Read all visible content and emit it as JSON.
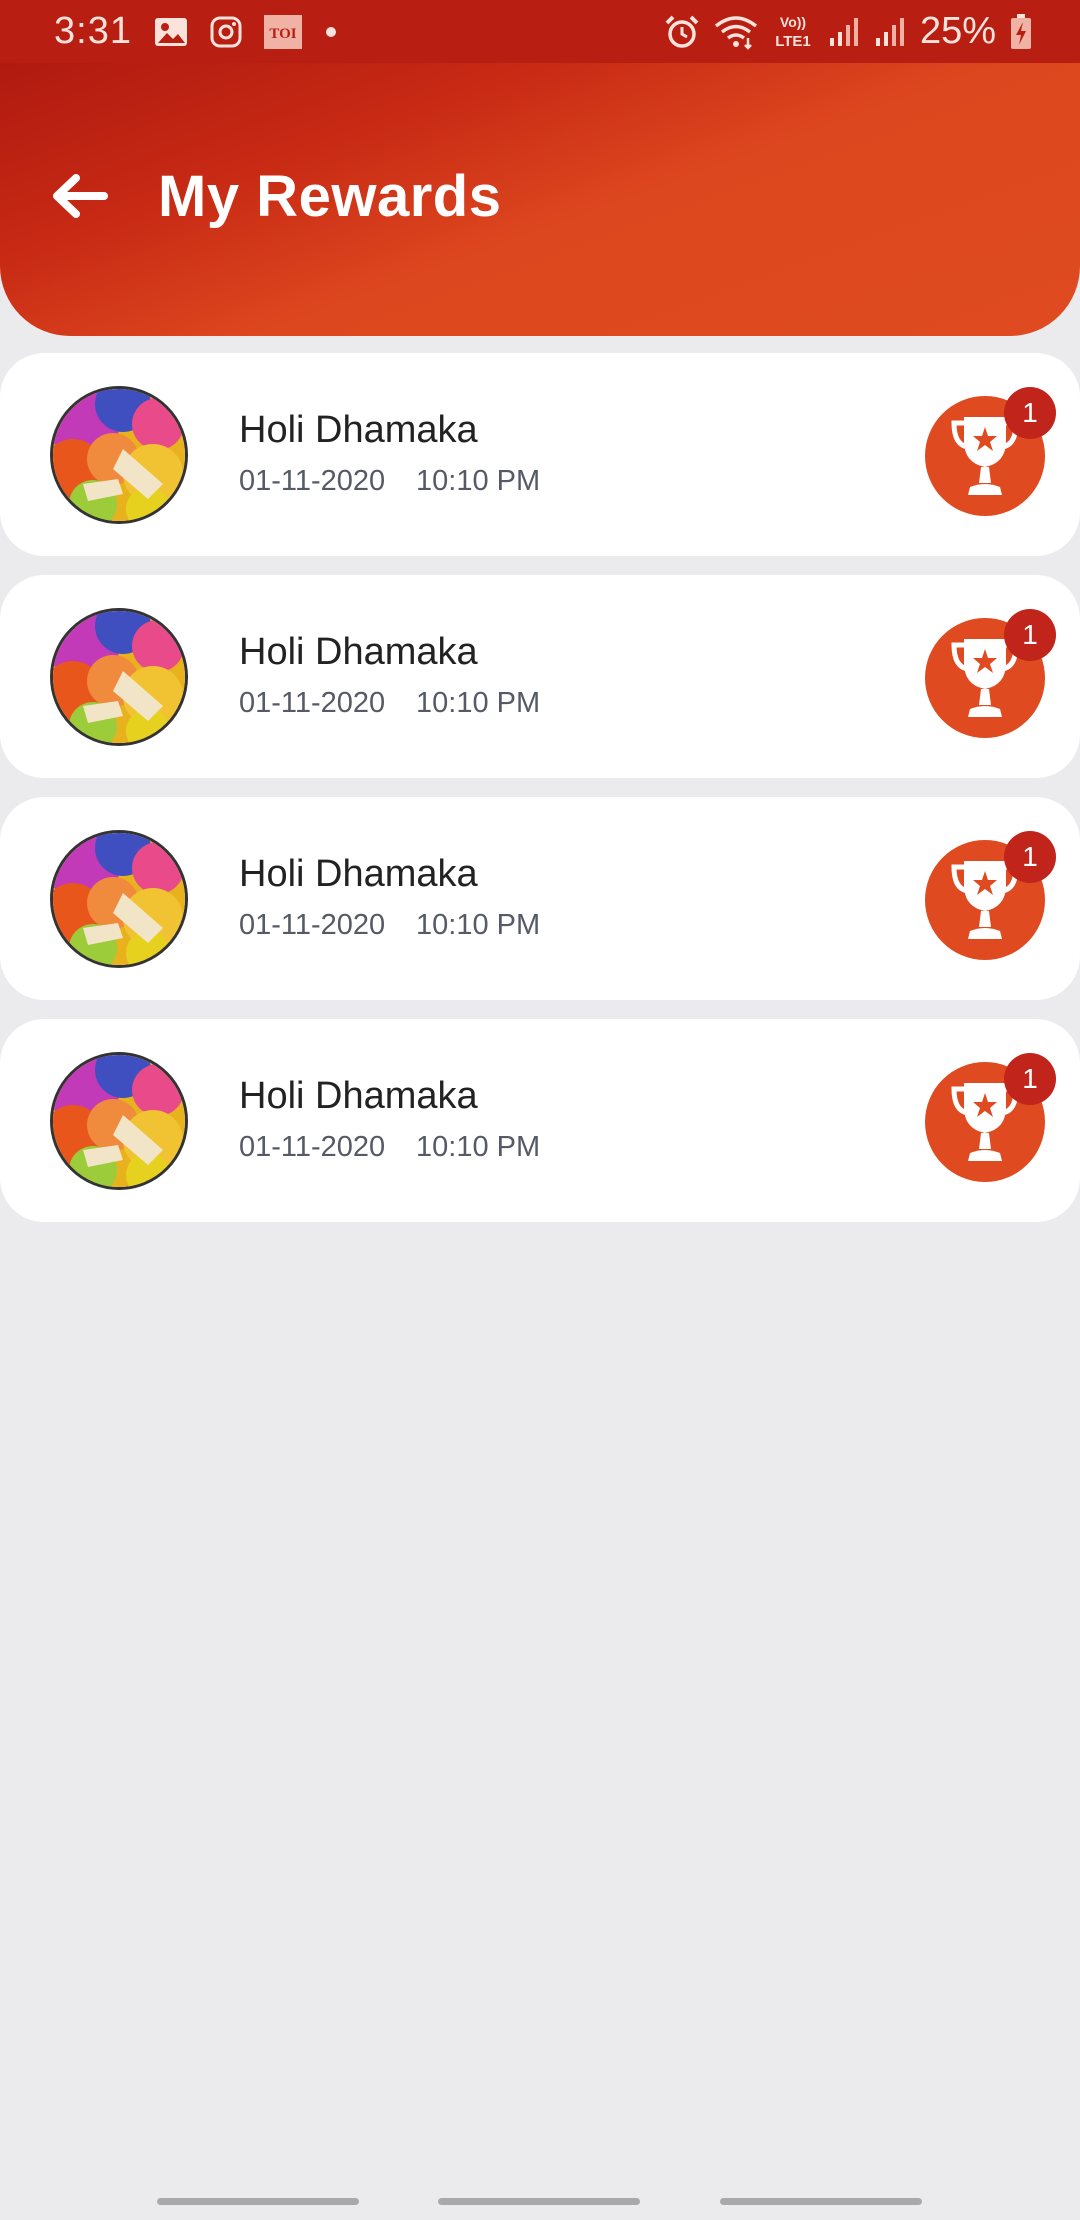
{
  "status_bar": {
    "time": "3:31",
    "left_icons": [
      "gallery-icon",
      "instagram-icon",
      "toi-icon",
      "dot-icon"
    ],
    "toi_label": "TOI",
    "right_icons": [
      "alarm-icon",
      "wifi-icon",
      "volte-lte1-icon",
      "signal-icon",
      "signal-icon",
      "battery-charging-icon"
    ],
    "volte_label": "Vo))",
    "lte_label": "LTE1",
    "battery": "25%"
  },
  "header": {
    "title": "My Rewards",
    "back_icon": "arrow-left-icon",
    "gradient_colors": [
      "#b01a10",
      "#df4b20"
    ]
  },
  "rewards": [
    {
      "title": "Holi Dhamaka",
      "date": "01-11-2020",
      "time": "10:10 PM",
      "badge": "1"
    },
    {
      "title": "Holi Dhamaka",
      "date": "01-11-2020",
      "time": "10:10 PM",
      "badge": "1"
    },
    {
      "title": "Holi Dhamaka",
      "date": "01-11-2020",
      "time": "10:10 PM",
      "badge": "1"
    },
    {
      "title": "Holi Dhamaka",
      "date": "01-11-2020",
      "time": "10:10 PM",
      "badge": "1"
    }
  ],
  "colors": {
    "status_bar": "#b81e12",
    "accent": "#df4a20",
    "badge": "#c0241a",
    "background": "#ebeaed",
    "card": "#ffffff"
  }
}
